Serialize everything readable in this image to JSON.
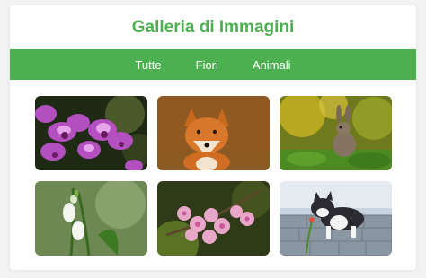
{
  "header": {
    "title": "Galleria di Immagini"
  },
  "nav": {
    "items": [
      {
        "label": "Tutte"
      },
      {
        "label": "Fiori"
      },
      {
        "label": "Animali"
      }
    ]
  },
  "gallery": {
    "images": [
      {
        "subject": "orchid-flowers",
        "category": "Fiori"
      },
      {
        "subject": "fox",
        "category": "Animali"
      },
      {
        "subject": "rabbit",
        "category": "Animali"
      },
      {
        "subject": "snowdrop-flowers",
        "category": "Fiori"
      },
      {
        "subject": "pink-blossom-flowers",
        "category": "Fiori"
      },
      {
        "subject": "kitten",
        "category": "Animali"
      }
    ]
  },
  "colors": {
    "accent": "#4caf50",
    "nav_text": "#ffffff",
    "background": "#f3f3f3"
  }
}
